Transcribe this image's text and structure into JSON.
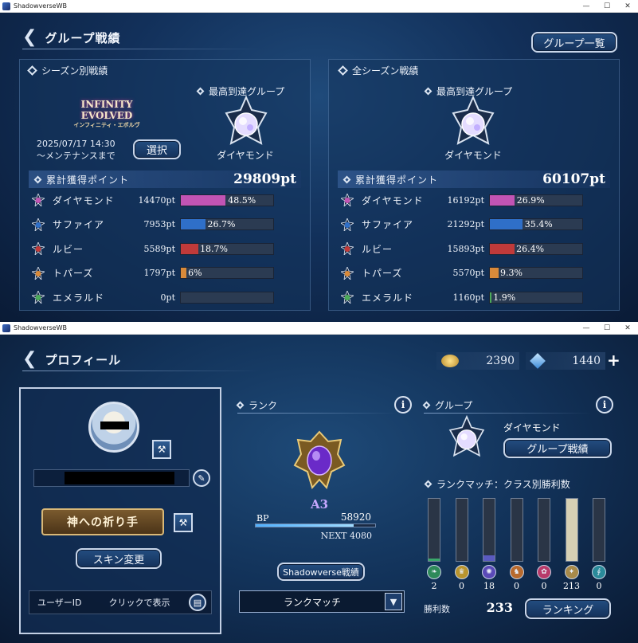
{
  "window1": {
    "title": "ShadowverseWB",
    "header_title": "グループ戦績",
    "group_list_button": "グループ一覧",
    "season": {
      "section_title": "シーズン別戦績",
      "logo_main": "INFINITY EVOLVED",
      "logo_sub": "インフィニティ・エボルヴ",
      "date_line1": "2025/07/17 14:30",
      "date_line2": "～メンテナンスまで",
      "select_button": "選択",
      "highest_group_label": "最高到達グループ",
      "highest_group_name": "ダイヤモンド",
      "points_label": "累計獲得ポイント",
      "total_points": "29809pt",
      "rows": [
        {
          "name": "ダイヤモンド",
          "points": "14470pt",
          "pct_label": "48.5%",
          "pct": 48.5,
          "color": "#c254b4",
          "icon": "diamond-gem-icon"
        },
        {
          "name": "サファイア",
          "points": "7953pt",
          "pct_label": "26.7%",
          "pct": 26.7,
          "color": "#2f6fc8",
          "icon": "sapphire-gem-icon"
        },
        {
          "name": "ルビー",
          "points": "5589pt",
          "pct_label": "18.7%",
          "pct": 18.7,
          "color": "#c03a3a",
          "icon": "ruby-gem-icon"
        },
        {
          "name": "トパーズ",
          "points": "1797pt",
          "pct_label": "6%",
          "pct": 6,
          "color": "#d98a3a",
          "icon": "topaz-gem-icon"
        },
        {
          "name": "エメラルド",
          "points": "0pt",
          "pct_label": "",
          "pct": 0,
          "color": "#4caa5a",
          "icon": "emerald-gem-icon"
        }
      ]
    },
    "all_season": {
      "section_title": "全シーズン戦績",
      "highest_group_label": "最高到達グループ",
      "highest_group_name": "ダイヤモンド",
      "points_label": "累計獲得ポイント",
      "total_points": "60107pt",
      "rows": [
        {
          "name": "ダイヤモンド",
          "points": "16192pt",
          "pct_label": "26.9%",
          "pct": 26.9,
          "color": "#c254b4",
          "icon": "diamond-gem-icon"
        },
        {
          "name": "サファイア",
          "points": "21292pt",
          "pct_label": "35.4%",
          "pct": 35.4,
          "color": "#2f6fc8",
          "icon": "sapphire-gem-icon"
        },
        {
          "name": "ルビー",
          "points": "15893pt",
          "pct_label": "26.4%",
          "pct": 26.4,
          "color": "#c03a3a",
          "icon": "ruby-gem-icon"
        },
        {
          "name": "トパーズ",
          "points": "5570pt",
          "pct_label": "9.3%",
          "pct": 9.3,
          "color": "#d98a3a",
          "icon": "topaz-gem-icon"
        },
        {
          "name": "エメラルド",
          "points": "1160pt",
          "pct_label": "1.9%",
          "pct": 1.9,
          "color": "#4caa5a",
          "icon": "emerald-gem-icon"
        }
      ]
    }
  },
  "window2": {
    "title": "ShadowverseWB",
    "header_title": "プロフィール",
    "currency1": "2390",
    "currency2": "1440",
    "plus": "+",
    "profile": {
      "title_name": "神への祈り手",
      "skin_button": "スキン変更",
      "user_id_label": "ユーザーID",
      "user_id_value": "クリックで表示"
    },
    "rank": {
      "section_title": "ランク",
      "rank_name": "A3",
      "bp_label": "BP",
      "bp_value": "58920",
      "bp_progress": 0.82,
      "next_label": "NEXT 4080",
      "record_button": "Shadowverse戦績",
      "mode_select": "ランクマッチ"
    },
    "group": {
      "section_title": "グループ",
      "group_name": "ダイヤモンド",
      "record_button": "グループ戦績",
      "class_wins_title": "ランクマッチ：クラス別勝利数",
      "classes": [
        {
          "icon": "forest-leaf-icon",
          "wins": "2",
          "value": 2,
          "color": "#2e8a5a",
          "glyph": "❧"
        },
        {
          "icon": "sword-crown-icon",
          "wins": "0",
          "value": 0,
          "color": "#b8942e",
          "glyph": "♛"
        },
        {
          "icon": "rune-circle-icon",
          "wins": "18",
          "value": 18,
          "color": "#5a4ab8",
          "glyph": "✺"
        },
        {
          "icon": "dragon-icon",
          "wins": "0",
          "value": 0,
          "color": "#b86a2e",
          "glyph": "♞"
        },
        {
          "icon": "abyss-skull-icon",
          "wins": "0",
          "value": 0,
          "color": "#b83a6a",
          "glyph": "✿"
        },
        {
          "icon": "haven-icon",
          "wins": "213",
          "value": 213,
          "color": "#a88a4a",
          "glyph": "✦"
        },
        {
          "icon": "portal-icon",
          "wins": "0",
          "value": 0,
          "color": "#2a8a9a",
          "glyph": "∮"
        }
      ],
      "wins_label": "勝利数",
      "total_wins": "233",
      "ranking_button": "ランキング"
    }
  }
}
